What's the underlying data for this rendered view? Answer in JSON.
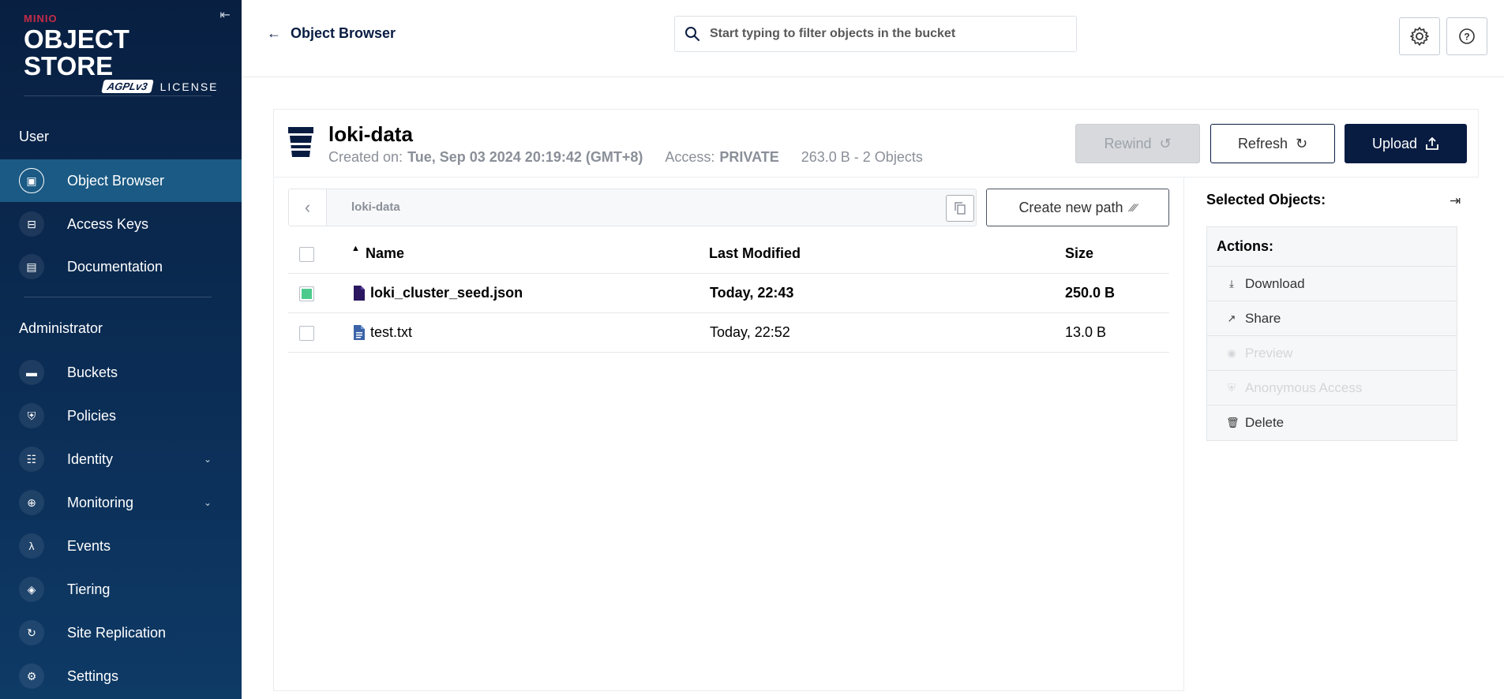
{
  "sidebar": {
    "logo": {
      "brand": "MINIO",
      "product": "OBJECT STORE",
      "agpl": "AGPLv3",
      "license": "LICENSE"
    },
    "sections": {
      "user": "User",
      "admin": "Administrator"
    },
    "items": [
      {
        "label": "Object Browser",
        "icon": "object-browser-icon"
      },
      {
        "label": "Access Keys",
        "icon": "access-keys-icon"
      },
      {
        "label": "Documentation",
        "icon": "documentation-icon"
      },
      {
        "label": "Buckets",
        "icon": "buckets-icon"
      },
      {
        "label": "Policies",
        "icon": "policies-icon"
      },
      {
        "label": "Identity",
        "icon": "identity-icon"
      },
      {
        "label": "Monitoring",
        "icon": "monitoring-icon"
      },
      {
        "label": "Events",
        "icon": "lambda-icon"
      },
      {
        "label": "Tiering",
        "icon": "tiering-icon"
      },
      {
        "label": "Site Replication",
        "icon": "site-replication-icon"
      },
      {
        "label": "Settings",
        "icon": "settings-icon"
      }
    ]
  },
  "topbar": {
    "back_label": "Object Browser",
    "search_placeholder": "Start typing to filter objects in the bucket"
  },
  "bucket": {
    "name": "loki-data",
    "created_label": "Created on:",
    "created_value": "Tue, Sep 03 2024 20:19:42 (GMT+8)",
    "access_label": "Access:",
    "access_value": "PRIVATE",
    "summary": "263.0 B - 2 Objects",
    "buttons": {
      "rewind": "Rewind",
      "refresh": "Refresh",
      "upload": "Upload"
    }
  },
  "path": {
    "current": "loki-data",
    "create_label": "Create new path"
  },
  "table": {
    "headers": {
      "name": "Name",
      "modified": "Last Modified",
      "size": "Size"
    },
    "rows": [
      {
        "name": "loki_cluster_seed.json",
        "modified": "Today, 22:43",
        "size": "250.0 B",
        "selected": true
      },
      {
        "name": "test.txt",
        "modified": "Today, 22:52",
        "size": "13.0 B",
        "selected": false
      }
    ]
  },
  "panel": {
    "title": "Selected Objects:",
    "actions_title": "Actions:",
    "actions": [
      {
        "label": "Download",
        "enabled": true
      },
      {
        "label": "Share",
        "enabled": true
      },
      {
        "label": "Preview",
        "enabled": false
      },
      {
        "label": "Anonymous Access",
        "enabled": false
      },
      {
        "label": "Delete",
        "enabled": true
      }
    ]
  },
  "colors": {
    "sidebar": "#081f41",
    "active": "#1b5a84",
    "primary": "#081c42",
    "brand": "#c72c48",
    "check": "#4ccb8d"
  }
}
